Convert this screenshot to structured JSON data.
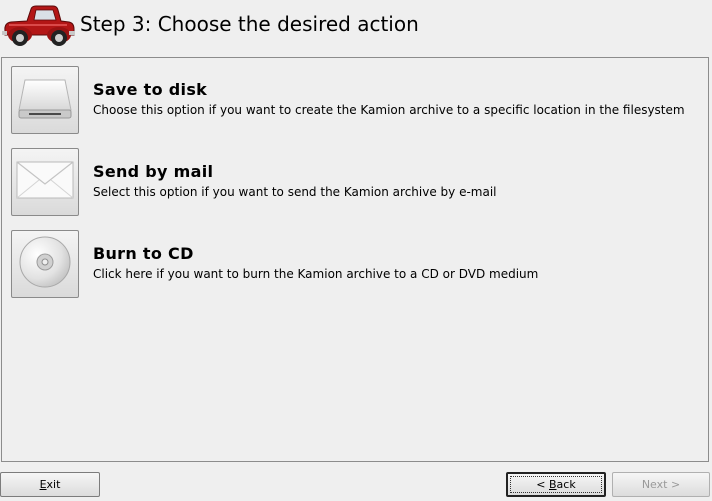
{
  "header": {
    "title": "Step 3: Choose the desired action",
    "logo_icon": "red-pickup-truck-icon"
  },
  "options": [
    {
      "title": "Save to disk",
      "description": "Choose this option if you want to create the Kamion archive to a specific location in the filesystem",
      "icon": "hard-disk-icon"
    },
    {
      "title": "Send by mail",
      "description": "Select this option if you want to send the Kamion archive by e-mail",
      "icon": "envelope-icon"
    },
    {
      "title": "Burn to CD",
      "description": "Click here if you want to burn the Kamion archive to a CD or DVD medium",
      "icon": "cd-disc-icon"
    }
  ],
  "buttons": {
    "exit": {
      "mnemonic": "E",
      "rest": "xit"
    },
    "back": {
      "prefix": "< ",
      "mnemonic": "B",
      "rest": "ack"
    },
    "next": {
      "text": "Next >",
      "enabled": false
    }
  },
  "colors": {
    "background": "#efefef",
    "panel_border": "#8c8c8c",
    "truck_red": "#c41a1a",
    "disabled_text": "#9a9a9a"
  }
}
